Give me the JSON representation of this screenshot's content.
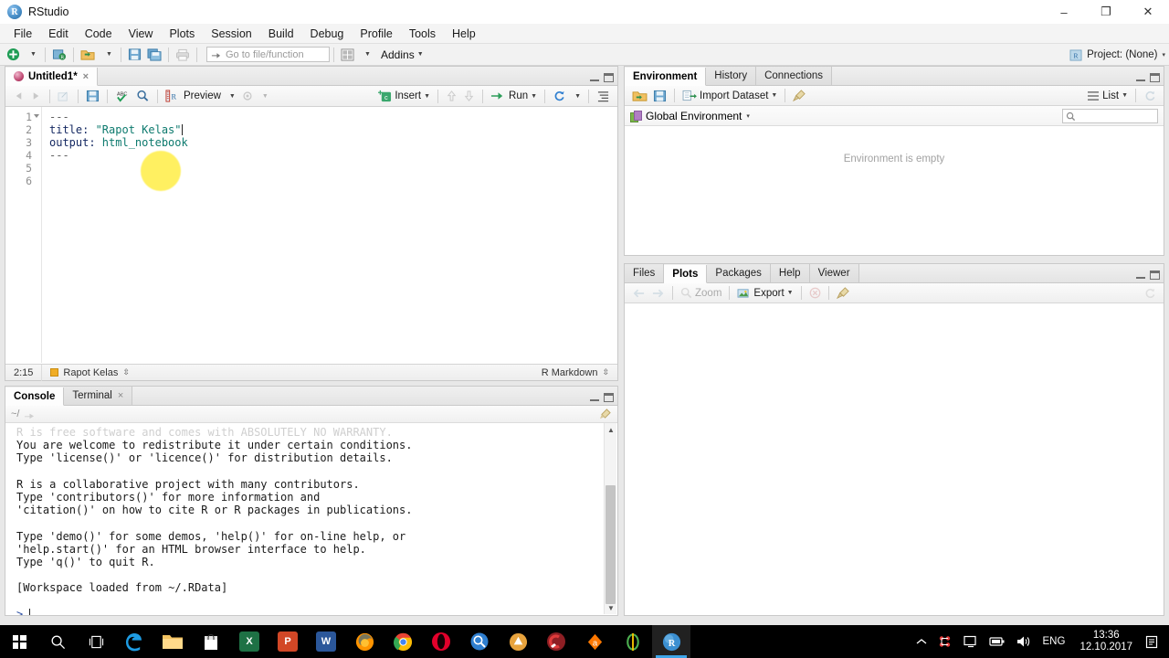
{
  "window": {
    "app_title": "RStudio",
    "logo_letter": "R",
    "minimize": "–",
    "restore": "❐",
    "close": "✕"
  },
  "menubar": {
    "items": [
      "File",
      "Edit",
      "Code",
      "View",
      "Plots",
      "Session",
      "Build",
      "Debug",
      "Profile",
      "Tools",
      "Help"
    ]
  },
  "toolbar": {
    "new_file_icon": "plus-circle-icon",
    "new_project_icon": "new-project-icon",
    "open_icon": "open-folder-icon",
    "save_icon": "save-icon",
    "save_all_icon": "save-all-icon",
    "print_icon": "print-icon",
    "goto_placeholder": "Go to file/function",
    "goto_value": "",
    "workspace_panes_icon": "panes-layout-icon",
    "addins_label": "Addins",
    "project_label": "Project: (None)"
  },
  "source": {
    "tab_label": "Untitled1*",
    "tab_close": "×",
    "toolbar": {
      "back_icon": "back-arrow-icon",
      "forward_icon": "forward-arrow-icon",
      "show_in_new_window_icon": "popout-window-icon",
      "save_icon": "save-icon",
      "spellcheck_icon": "spellcheck-icon",
      "find_icon": "find-replace-icon",
      "knit_icon": "knit-icon",
      "preview_label": "Preview",
      "gear_icon": "gear-icon",
      "insert_label": "Insert",
      "insert_icon": "insert-chunk-icon",
      "chunk_up_icon": "previous-chunk-icon",
      "chunk_down_icon": "next-chunk-icon",
      "run_label": "Run",
      "run_icon": "run-icon",
      "rerun_icon": "rerun-chunks-icon",
      "outline_icon": "document-outline-icon"
    },
    "gutter": [
      "1",
      "2",
      "3",
      "4",
      "5",
      "6"
    ],
    "code": [
      {
        "type": "dash",
        "text": "---"
      },
      {
        "type": "yaml",
        "key": "title:",
        "value": " \"Rapot Kelas\""
      },
      {
        "type": "yaml",
        "key": "output:",
        "value": " html_notebook"
      },
      {
        "type": "dash",
        "text": "---"
      },
      {
        "type": "blank",
        "text": ""
      },
      {
        "type": "blank",
        "text": ""
      }
    ],
    "status": {
      "position": "2:15",
      "scope": "Rapot Kelas",
      "filetype": "R Markdown"
    }
  },
  "console": {
    "tabs": [
      {
        "label": "Console",
        "active": true,
        "closable": false
      },
      {
        "label": "Terminal",
        "active": false,
        "closable": true
      }
    ],
    "path": "~/",
    "broom_icon": "clear-console-icon",
    "lines": [
      "R is free software and comes with ABSOLUTELY NO WARRANTY.",
      "You are welcome to redistribute it under certain conditions.",
      "Type 'license()' or 'licence()' for distribution details.",
      "",
      "R is a collaborative project with many contributors.",
      "Type 'contributors()' for more information and",
      "'citation()' on how to cite R or R packages in publications.",
      "",
      "Type 'demo()' for some demos, 'help()' for on-line help, or",
      "'help.start()' for an HTML browser interface to help.",
      "Type 'q()' to quit R.",
      "",
      "[Workspace loaded from ~/.RData]",
      ""
    ],
    "prompt": ">"
  },
  "environment": {
    "tabs": [
      {
        "label": "Environment",
        "active": true
      },
      {
        "label": "History",
        "active": false
      },
      {
        "label": "Connections",
        "active": false
      }
    ],
    "toolbar": {
      "load_icon": "load-workspace-icon",
      "save_icon": "save-workspace-icon",
      "import_label": "Import Dataset",
      "import_icon": "import-dataset-icon",
      "clear_icon": "clear-workspace-broom-icon",
      "list_label": "List",
      "list_icon": "list-view-icon",
      "refresh_icon": "refresh-icon"
    },
    "scope_label": "Global Environment",
    "search_placeholder": "",
    "search_value": "",
    "search_icon": "search-icon",
    "empty_message": "Environment is empty"
  },
  "files_pane": {
    "tabs": [
      {
        "label": "Files",
        "active": false
      },
      {
        "label": "Plots",
        "active": true
      },
      {
        "label": "Packages",
        "active": false
      },
      {
        "label": "Help",
        "active": false
      },
      {
        "label": "Viewer",
        "active": false
      }
    ],
    "toolbar": {
      "prev_icon": "previous-plot-icon",
      "next_icon": "next-plot-icon",
      "zoom_label": "Zoom",
      "zoom_icon": "zoom-plot-icon",
      "export_label": "Export",
      "export_icon": "export-plot-icon",
      "remove_icon": "remove-plot-icon",
      "clear_icon": "clear-plots-broom-icon",
      "refresh_icon": "refresh-icon"
    }
  },
  "taskbar": {
    "start_icon": "windows-start-icon",
    "items": [
      {
        "name": "search-icon",
        "glyph": "⌕",
        "color": "#ffffff",
        "kind": "glyph"
      },
      {
        "name": "task-view-icon",
        "glyph": "❑",
        "color": "#ffffff",
        "kind": "glyph"
      },
      {
        "name": "microsoft-edge-icon",
        "glyph": "e",
        "color": "#0c7ebf",
        "kind": "edge"
      },
      {
        "name": "file-explorer-icon",
        "glyph": "",
        "color": "#f2b33d",
        "kind": "folder"
      },
      {
        "name": "microsoft-store-icon",
        "glyph": "",
        "color": "#ffffff",
        "kind": "store"
      },
      {
        "name": "microsoft-excel-icon",
        "glyph": "X",
        "color": "#1e7145",
        "kind": "sq"
      },
      {
        "name": "microsoft-powerpoint-icon",
        "glyph": "P",
        "color": "#d24726",
        "kind": "sq"
      },
      {
        "name": "microsoft-word-icon",
        "glyph": "W",
        "color": "#2b579a",
        "kind": "sq"
      },
      {
        "name": "mozilla-firefox-icon",
        "glyph": "",
        "color": "#e66000",
        "kind": "firefox"
      },
      {
        "name": "google-chrome-icon",
        "glyph": "",
        "color": "#4285f4",
        "kind": "chrome"
      },
      {
        "name": "opera-browser-icon",
        "glyph": "O",
        "color": "#e4002b",
        "kind": "circ"
      },
      {
        "name": "desktop-search-icon",
        "glyph": "⌕",
        "color": "#2f7fd0",
        "kind": "circ"
      },
      {
        "name": "avira-icon",
        "glyph": "▲",
        "color": "#e8a33d",
        "kind": "circ"
      },
      {
        "name": "ccleaner-icon",
        "glyph": "C",
        "color": "#b72025",
        "kind": "circ"
      },
      {
        "name": "avast-icon",
        "glyph": "a",
        "color": "#ff7800",
        "kind": "circ"
      },
      {
        "name": "qbittorrent-icon",
        "glyph": "q",
        "color": "#4caf50",
        "kind": "circ"
      },
      {
        "name": "rstudio-icon",
        "glyph": "R",
        "color": "#2a6ba3",
        "kind": "circ",
        "active": true
      }
    ],
    "tray": {
      "expand_icon": "show-hidden-icons-chevron",
      "network_share_icon": "network-icon",
      "display_icon": "display-icon",
      "battery_icon": "battery-icon",
      "volume_icon": "volume-icon",
      "language": "ENG",
      "time": "13:36",
      "date": "12.10.2017",
      "action_center_icon": "action-center-icon"
    }
  }
}
